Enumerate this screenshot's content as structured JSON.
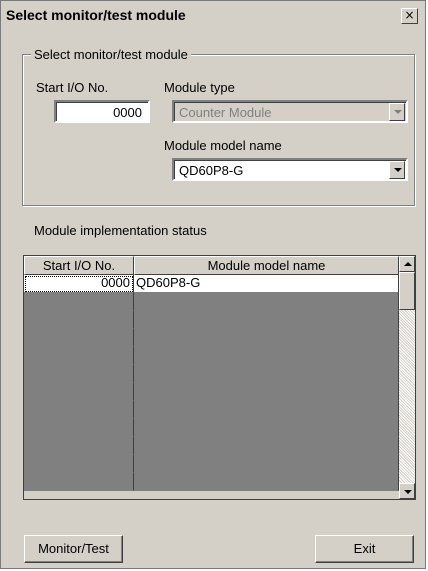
{
  "window": {
    "title": "Select monitor/test module",
    "close_label": "×"
  },
  "group": {
    "legend": "Select monitor/test module",
    "start_io_label": "Start I/O No.",
    "start_io_value": "0000",
    "module_type_label": "Module type",
    "module_type_value": "Counter Module",
    "model_name_label": "Module model name",
    "model_name_value": "QD60P8-G"
  },
  "status": {
    "label": "Module implementation status",
    "columns": [
      "Start I/O No.",
      "Module model name"
    ],
    "rows": [
      {
        "start_io": "0000",
        "model": "QD60P8-G"
      }
    ]
  },
  "buttons": {
    "monitor_test": "Monitor/Test",
    "exit": "Exit"
  },
  "colors": {
    "face": "#d4d0c8",
    "empty_cell": "#808080"
  }
}
